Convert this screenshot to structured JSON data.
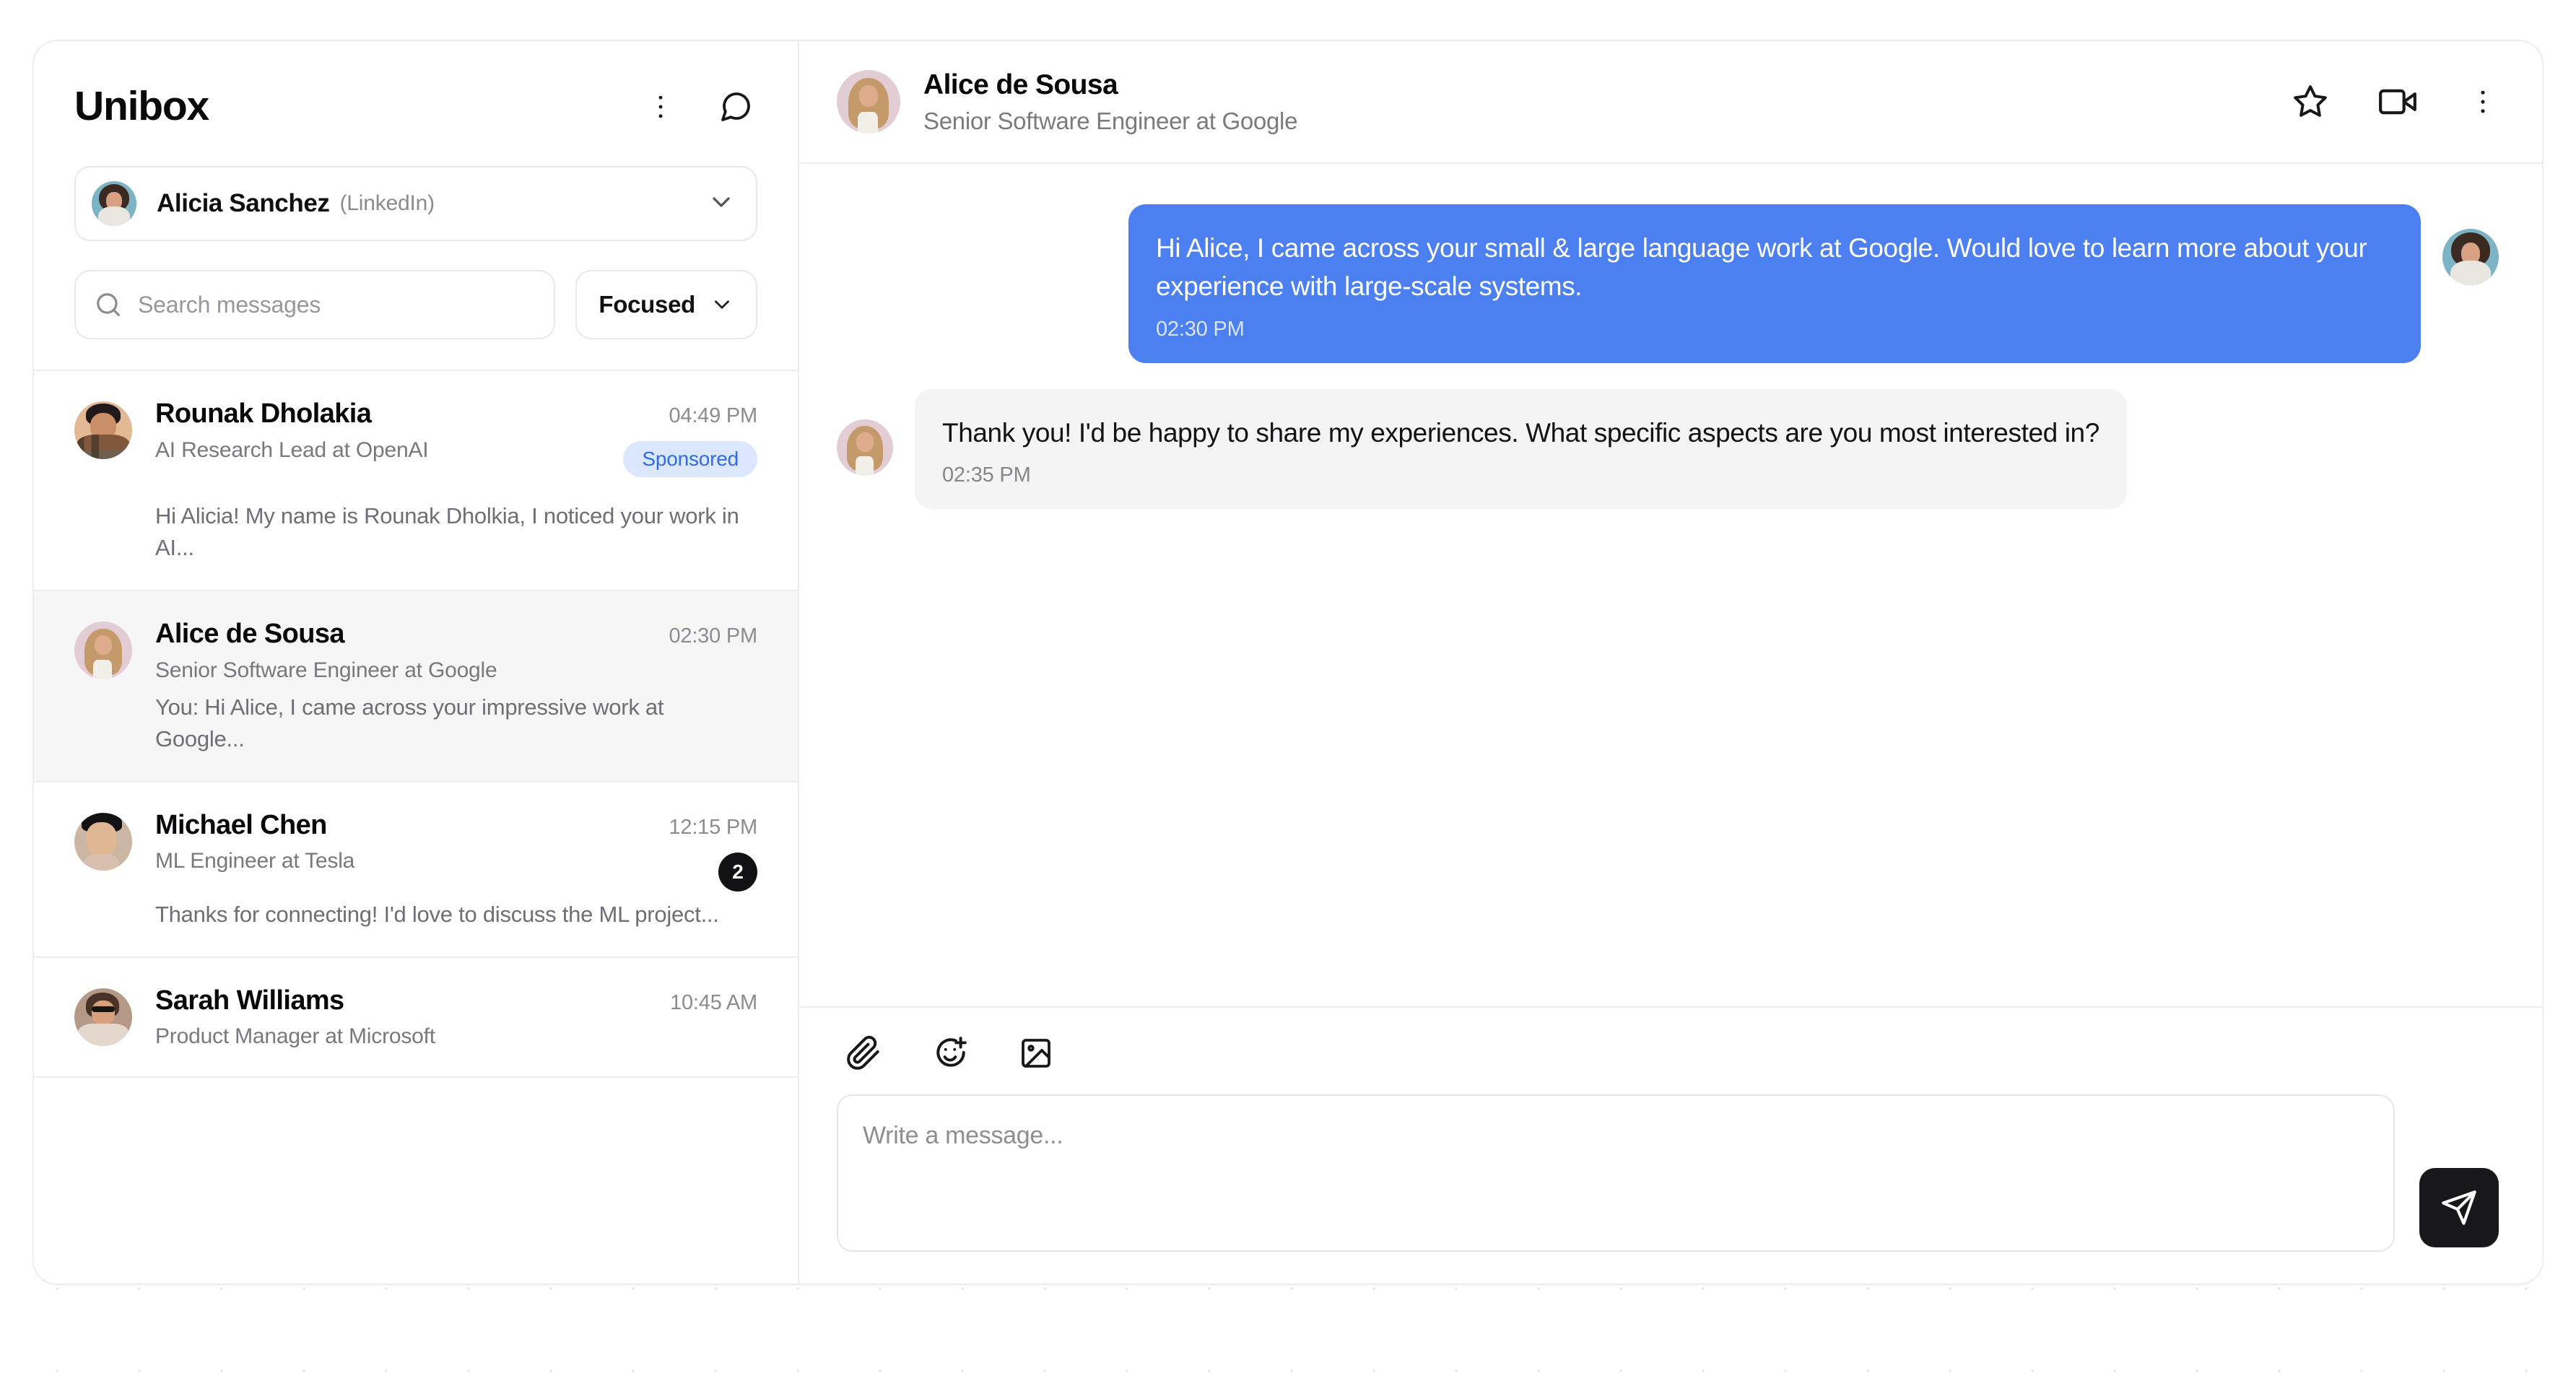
{
  "app": {
    "title": "Unibox"
  },
  "left_header": {
    "more_icon": "more-vertical-icon",
    "compose_icon": "message-square-icon"
  },
  "account": {
    "name": "Alicia Sanchez",
    "provider": "(LinkedIn)",
    "avatar": "alicia-avatar",
    "chevron_icon": "chevron-down-icon"
  },
  "search": {
    "placeholder": "Search messages",
    "value": "",
    "icon": "search-icon"
  },
  "filter": {
    "label": "Focused",
    "chevron_icon": "chevron-down-icon"
  },
  "conversations": [
    {
      "name": "Rounak Dholakia",
      "role": "AI Research Lead at OpenAI",
      "time": "04:49 PM",
      "preview": "Hi Alicia! My name is Rounak Dholkia, I noticed your work in AI...",
      "badge": "Sponsored",
      "badge_type": "sponsored",
      "selected": false
    },
    {
      "name": "Alice de Sousa",
      "role": "Senior Software Engineer at Google",
      "time": "02:30 PM",
      "preview": "You: Hi Alice, I came across your impressive work at Google...",
      "badge": "",
      "badge_type": "none",
      "selected": true
    },
    {
      "name": "Michael Chen",
      "role": "ML Engineer at Tesla",
      "time": "12:15 PM",
      "preview": "Thanks for connecting! I'd love to discuss the ML project...",
      "badge": "2",
      "badge_type": "unread",
      "selected": false
    },
    {
      "name": "Sarah Williams",
      "role": "Product Manager at Microsoft",
      "time": "10:45 AM",
      "preview": "",
      "badge": "",
      "badge_type": "none",
      "selected": false
    }
  ],
  "chat_header": {
    "name": "Alice de Sousa",
    "role": "Senior Software Engineer at Google",
    "avatar": "alice-avatar",
    "star_icon": "star-icon",
    "video_icon": "video-camera-icon",
    "more_icon": "more-vertical-icon"
  },
  "messages": [
    {
      "direction": "outgoing",
      "text": "Hi Alice, I came across your small & large language work at Google. Would love to learn more about your experience with large-scale systems.",
      "time": "02:30 PM",
      "avatar": "alicia-avatar"
    },
    {
      "direction": "incoming",
      "text": "Thank you! I'd be happy to share my experiences. What specific aspects are you most interested in?",
      "time": "02:35 PM",
      "avatar": "alice-avatar"
    }
  ],
  "composer": {
    "attach_icon": "paperclip-icon",
    "emoji_icon": "smile-plus-icon",
    "image_icon": "image-icon",
    "placeholder": "Write a message...",
    "value": "",
    "send_icon": "send-icon"
  },
  "colors": {
    "accent_blue": "#4c7ff0",
    "sponsored_bg": "#dbe7fe",
    "sponsored_text": "#2f6bea",
    "unread_bg": "#121214",
    "send_bg": "#18181b",
    "received_bubble": "#f4f4f5",
    "selected_row": "#f6f6f7",
    "border": "#ededef"
  }
}
